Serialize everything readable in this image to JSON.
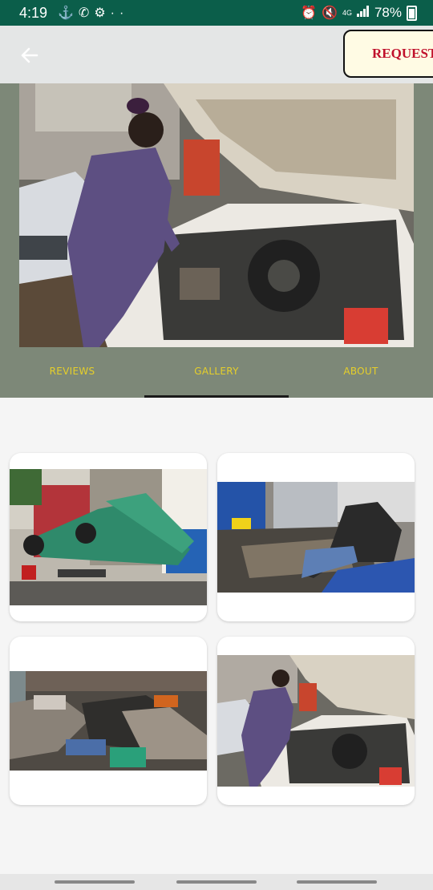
{
  "status_bar": {
    "time": "4:19",
    "network": "4G",
    "battery": "78%",
    "icons": [
      "ship-wheel-icon",
      "whatsapp-icon",
      "android-auto-icon",
      "more-dots-icon",
      "alarm-icon",
      "mute-icon",
      "signal-icon",
      "battery-icon"
    ]
  },
  "app_bar": {
    "back_icon": "arrow-left-icon",
    "request_label": "REQUEST"
  },
  "tabs": [
    {
      "label": "REVIEWS"
    },
    {
      "label": "GALLERY",
      "selected": true
    },
    {
      "label": "ABOUT"
    }
  ],
  "colors": {
    "status_bar": "#0b5e4a",
    "app_bar": "#e4e6e6",
    "hero_bg": "#7d8878",
    "tab_text": "#e6cf2a",
    "request_text": "#c0102b",
    "request_bg": "#fffbe4"
  },
  "gallery": [
    {
      "name": "tipped-pickup-truck-photo"
    },
    {
      "name": "mechanic-in-car-photo"
    },
    {
      "name": "scrap-parts-yard-photo"
    },
    {
      "name": "mechanic-engine-photo"
    }
  ]
}
